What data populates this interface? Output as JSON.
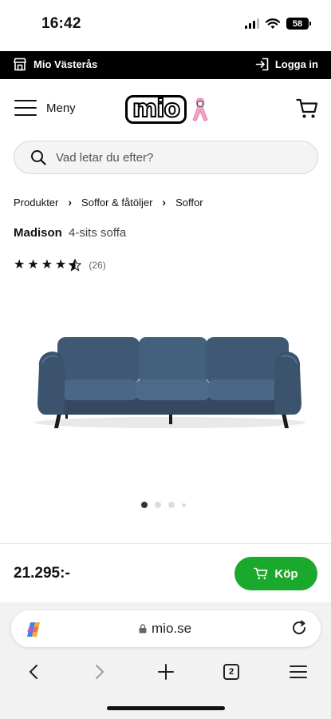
{
  "status": {
    "time": "16:42",
    "battery": "58"
  },
  "storebar": {
    "store": "Mio Västerås",
    "login": "Logga in"
  },
  "header": {
    "menu": "Meny",
    "logo": "mio"
  },
  "search": {
    "placeholder": "Vad letar du efter?"
  },
  "breadcrumbs": [
    "Produkter",
    "Soffor & fåtöljer",
    "Soffor"
  ],
  "product": {
    "name": "Madison",
    "subtitle": "4-sits soffa",
    "rating": 4.5,
    "reviews": "(26)",
    "image_alt": "Blue 4-seater sofa",
    "sofa_color": "#3f5873"
  },
  "carousel": {
    "total": 4,
    "active": 0
  },
  "pricebar": {
    "price": "21.295:-",
    "buy": "Köp",
    "buy_color": "#1aa82d"
  },
  "browser": {
    "url": "mio.se",
    "tabs": "2"
  }
}
